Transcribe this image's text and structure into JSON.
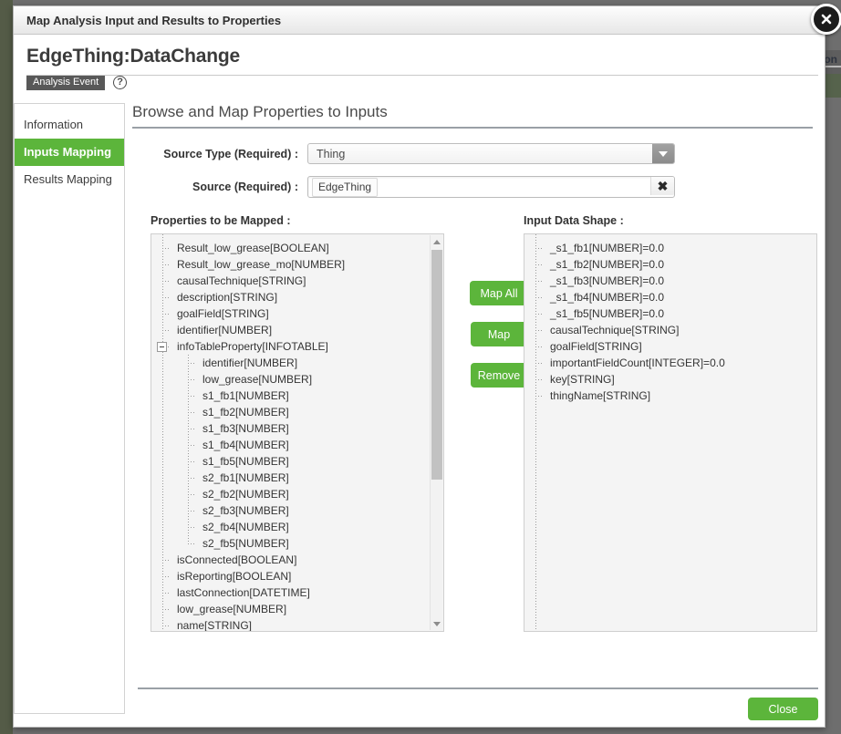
{
  "background": {
    "partial_text": "ion"
  },
  "window": {
    "title": "Map Analysis Input and Results to Properties",
    "close_icon": "close-circle-icon"
  },
  "header": {
    "entity_title": "EdgeThing:DataChange",
    "badge": "Analysis Event",
    "help_icon": "?"
  },
  "sidebar": {
    "items": [
      {
        "label": "Information",
        "active": false
      },
      {
        "label": "Inputs Mapping",
        "active": true
      },
      {
        "label": "Results Mapping",
        "active": false
      }
    ]
  },
  "main": {
    "title": "Browse and Map Properties to Inputs",
    "form": {
      "source_type": {
        "label": "Source Type (Required) :",
        "value": "Thing",
        "arrow_icon": "chevron-down-icon"
      },
      "source": {
        "label": "Source (Required) :",
        "value": "EdgeThing",
        "clear_icon": "✖"
      }
    },
    "left_panel": {
      "label": "Properties to be Mapped :",
      "items": [
        {
          "text": "Result_low_grease[BOOLEAN]",
          "level": 1,
          "toggle": false
        },
        {
          "text": "Result_low_grease_mo[NUMBER]",
          "level": 1,
          "toggle": false
        },
        {
          "text": "causalTechnique[STRING]",
          "level": 1,
          "toggle": false
        },
        {
          "text": "description[STRING]",
          "level": 1,
          "toggle": false
        },
        {
          "text": "goalField[STRING]",
          "level": 1,
          "toggle": false
        },
        {
          "text": "identifier[NUMBER]",
          "level": 1,
          "toggle": false
        },
        {
          "text": "infoTableProperty[INFOTABLE]",
          "level": 1,
          "toggle": true
        },
        {
          "text": "identifier[NUMBER]",
          "level": 2,
          "toggle": false
        },
        {
          "text": "low_grease[NUMBER]",
          "level": 2,
          "toggle": false
        },
        {
          "text": "s1_fb1[NUMBER]",
          "level": 2,
          "toggle": false
        },
        {
          "text": "s1_fb2[NUMBER]",
          "level": 2,
          "toggle": false
        },
        {
          "text": "s1_fb3[NUMBER]",
          "level": 2,
          "toggle": false
        },
        {
          "text": "s1_fb4[NUMBER]",
          "level": 2,
          "toggle": false
        },
        {
          "text": "s1_fb5[NUMBER]",
          "level": 2,
          "toggle": false
        },
        {
          "text": "s2_fb1[NUMBER]",
          "level": 2,
          "toggle": false
        },
        {
          "text": "s2_fb2[NUMBER]",
          "level": 2,
          "toggle": false
        },
        {
          "text": "s2_fb3[NUMBER]",
          "level": 2,
          "toggle": false
        },
        {
          "text": "s2_fb4[NUMBER]",
          "level": 2,
          "toggle": false
        },
        {
          "text": "s2_fb5[NUMBER]",
          "level": 2,
          "toggle": false
        },
        {
          "text": "isConnected[BOOLEAN]",
          "level": 1,
          "toggle": false
        },
        {
          "text": "isReporting[BOOLEAN]",
          "level": 1,
          "toggle": false
        },
        {
          "text": "lastConnection[DATETIME]",
          "level": 1,
          "toggle": false
        },
        {
          "text": "low_grease[NUMBER]",
          "level": 1,
          "toggle": false
        },
        {
          "text": "name[STRING]",
          "level": 1,
          "toggle": false
        }
      ]
    },
    "buttons": {
      "map_all": "Map All",
      "map": "Map",
      "remove": "Remove"
    },
    "right_panel": {
      "label": "Input Data Shape :",
      "items": [
        {
          "text": "_s1_fb1[NUMBER]=0.0",
          "level": 1
        },
        {
          "text": "_s1_fb2[NUMBER]=0.0",
          "level": 1
        },
        {
          "text": "_s1_fb3[NUMBER]=0.0",
          "level": 1
        },
        {
          "text": "_s1_fb4[NUMBER]=0.0",
          "level": 1
        },
        {
          "text": "_s1_fb5[NUMBER]=0.0",
          "level": 1
        },
        {
          "text": "causalTechnique[STRING]",
          "level": 1
        },
        {
          "text": "goalField[STRING]",
          "level": 1
        },
        {
          "text": "importantFieldCount[INTEGER]=0.0",
          "level": 1
        },
        {
          "text": "key[STRING]",
          "level": 1
        },
        {
          "text": "thingName[STRING]",
          "level": 1
        }
      ]
    }
  },
  "footer": {
    "close_label": "Close"
  },
  "colors": {
    "accent_green": "#5cb53b",
    "title_text": "#303030",
    "backdrop": "#6e6e6e"
  }
}
